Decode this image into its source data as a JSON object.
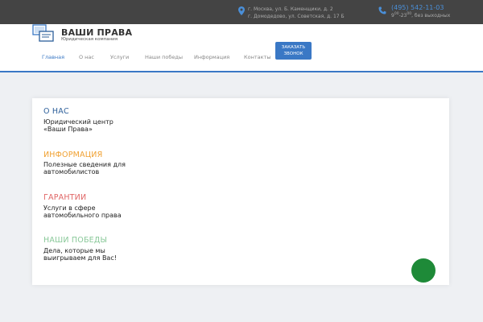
{
  "header": {
    "brand": "ВАШИ ПРАВА",
    "tagline": "Юридическая компания",
    "address": {
      "line1": "г. Москва, ул. Б. Каменщики, д. 2",
      "line2": "г. Домодедово, ул. Советская, д. 17 Б",
      "icon": "map-pin-icon"
    },
    "phone": {
      "number": "(495) 542-11-03",
      "hours_start": "9",
      "hours_start_sup": "00",
      "hours_end": "-23",
      "hours_end_sup": "00",
      "hours_suffix": ", без выходных",
      "icon": "phone-icon"
    },
    "order_button": {
      "line1": "ЗАКАЗАТЬ",
      "line2": "ЗВОНОК"
    }
  },
  "nav": {
    "items": [
      {
        "label": "Главная",
        "active": true
      },
      {
        "label": "О нас",
        "active": false
      },
      {
        "label": "Услуги",
        "active": false
      },
      {
        "label": "Наши победы",
        "active": false
      },
      {
        "label": "Информация",
        "active": false
      },
      {
        "label": "Контакты",
        "active": false
      }
    ]
  },
  "sections": [
    {
      "title": "О НАС",
      "color": "#2d5f9a",
      "text1": "Юридический центр",
      "text2": "«Ваши Права»"
    },
    {
      "title": "ИНФОРМАЦИЯ",
      "color": "#f0a030",
      "text1": "Полезные сведения для",
      "text2": "автомобилистов"
    },
    {
      "title": "ГАРАНТИИ",
      "color": "#e06666",
      "text1": "Услуги в сфере",
      "text2": "автомобильного права"
    },
    {
      "title": "НАШИ ПОБЕДЫ",
      "color": "#88c898",
      "text1": "Дела, которые мы",
      "text2": "выигрываем для Вас!"
    }
  ],
  "colors": {
    "accent": "#3a78c5",
    "topbar": "#444444",
    "fab": "#1e8a38"
  }
}
